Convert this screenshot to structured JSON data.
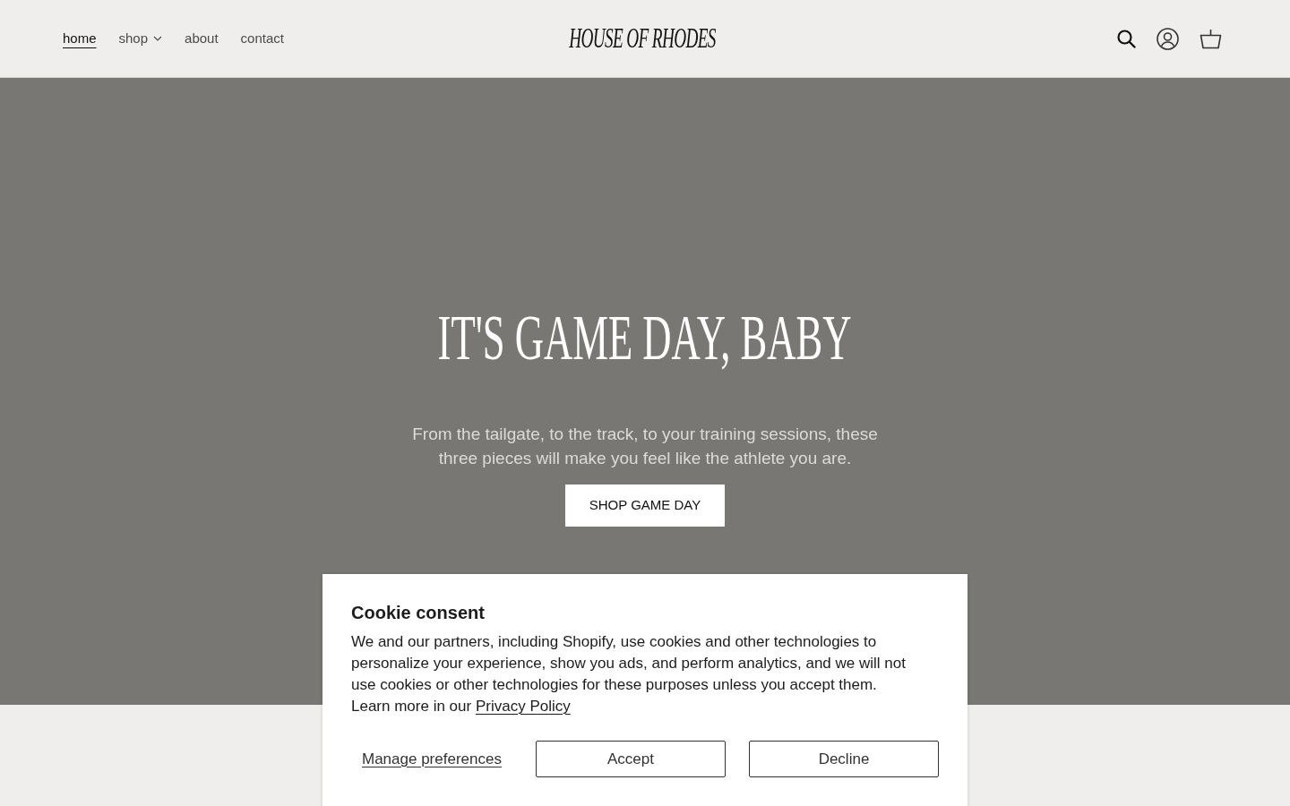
{
  "header": {
    "nav": [
      {
        "label": "home",
        "selected": true,
        "dropdown": false
      },
      {
        "label": "shop",
        "selected": false,
        "dropdown": true
      },
      {
        "label": "about",
        "selected": false,
        "dropdown": false
      },
      {
        "label": "contact",
        "selected": false,
        "dropdown": false
      }
    ],
    "logo": "HOUSE OF RHODES"
  },
  "hero": {
    "title": "IT'S GAME DAY, BABY",
    "subtitle": "From the tailgate, to the track, to your training sessions, these three pieces will make you feel like the athlete you are.",
    "button": "SHOP GAME DAY"
  },
  "cookie_consent": {
    "title": "Cookie consent",
    "body": "We and our partners, including Shopify, use cookies and other technologies to personalize your experience, show you ads, and perform analytics, and we will not use cookies or other technologies for these purposes unless you accept them. Learn more in our",
    "link": "Privacy Policy",
    "buttons": [
      {
        "label": "Manage preferences",
        "kind": "link"
      },
      {
        "label": "Accept",
        "kind": "outline"
      },
      {
        "label": "Decline",
        "kind": "outline"
      }
    ]
  }
}
